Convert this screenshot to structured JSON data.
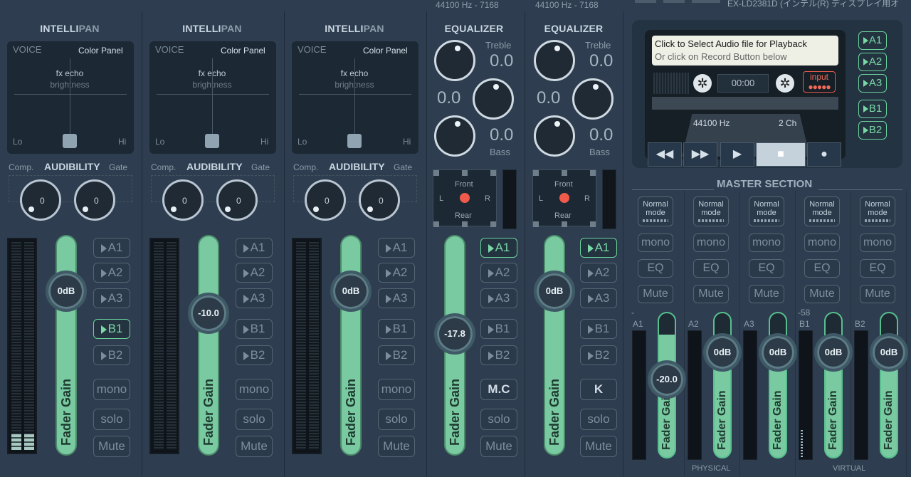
{
  "top": {
    "freq1": "44100 Hz - 7168",
    "freq2": "44100 Hz - 7168",
    "device": "EX-LD2381D (インテル(R) ディスプレイ用オ"
  },
  "strips": [
    {
      "id": "hw1",
      "pan": {
        "title_a": "INTELLI",
        "title_b": "PAN",
        "voice": "VOICE",
        "color": "Color Panel",
        "fx": "fx echo",
        "bright": "brightness",
        "lo": "Lo",
        "hi": "Hi"
      },
      "aud": {
        "comp": "Comp.",
        "title": "AUDIBILITY",
        "gate": "Gate",
        "k1": "0",
        "k2": "0"
      },
      "fader": {
        "value": "0dB",
        "label": "Fader Gain"
      },
      "buses": [
        {
          "label": "A1",
          "on": false
        },
        {
          "label": "A2",
          "on": false
        },
        {
          "label": "A3",
          "on": false
        },
        {
          "label": "B1",
          "on": true
        },
        {
          "label": "B2",
          "on": false
        }
      ],
      "btns": [
        "mono",
        "solo",
        "Mute"
      ]
    },
    {
      "id": "hw2",
      "pan": {
        "title_a": "INTELLI",
        "title_b": "PAN",
        "voice": "VOICE",
        "color": "Color Panel",
        "fx": "fx echo",
        "bright": "brightness",
        "lo": "Lo",
        "hi": "Hi"
      },
      "aud": {
        "comp": "Comp.",
        "title": "AUDIBILITY",
        "gate": "Gate",
        "k1": "0",
        "k2": "0"
      },
      "fader": {
        "value": "-10.0",
        "label": "Fader Gain"
      },
      "buses": [
        {
          "label": "A1",
          "on": false
        },
        {
          "label": "A2",
          "on": false
        },
        {
          "label": "A3",
          "on": false
        },
        {
          "label": "B1",
          "on": false
        },
        {
          "label": "B2",
          "on": false
        }
      ],
      "btns": [
        "mono",
        "solo",
        "Mute"
      ]
    },
    {
      "id": "hw3",
      "pan": {
        "title_a": "INTELLI",
        "title_b": "PAN",
        "voice": "VOICE",
        "color": "Color Panel",
        "fx": "fx echo",
        "bright": "brightness",
        "lo": "Lo",
        "hi": "Hi"
      },
      "aud": {
        "comp": "Comp.",
        "title": "AUDIBILITY",
        "gate": "Gate",
        "k1": "0",
        "k2": "0"
      },
      "fader": {
        "value": "0dB",
        "label": "Fader Gain"
      },
      "buses": [
        {
          "label": "A1",
          "on": false
        },
        {
          "label": "A2",
          "on": false
        },
        {
          "label": "A3",
          "on": false
        },
        {
          "label": "B1",
          "on": false
        },
        {
          "label": "B2",
          "on": false
        }
      ],
      "btns": [
        "mono",
        "solo",
        "Mute"
      ]
    }
  ],
  "virtual": [
    {
      "id": "v1",
      "eq": {
        "title": "EQUALIZER",
        "treble": "Treble",
        "bass": "Bass",
        "tv": "0.0",
        "mv": "0.0",
        "bv": "0.0"
      },
      "pan": {
        "front": "Front",
        "rear": "Rear",
        "l": "L",
        "r": "R"
      },
      "fader": {
        "value": "-17.8",
        "label": "Fader Gain"
      },
      "buses": [
        {
          "label": "A1",
          "on": true
        },
        {
          "label": "A2",
          "on": false
        },
        {
          "label": "A3",
          "on": false
        },
        {
          "label": "B1",
          "on": false
        },
        {
          "label": "B2",
          "on": false
        }
      ],
      "btns": [
        "M.C",
        "solo",
        "Mute"
      ]
    },
    {
      "id": "v2",
      "eq": {
        "title": "EQUALIZER",
        "treble": "Treble",
        "bass": "Bass",
        "tv": "0.0",
        "mv": "0.0",
        "bv": "0.0"
      },
      "pan": {
        "front": "Front",
        "rear": "Rear",
        "l": "L",
        "r": "R"
      },
      "fader": {
        "value": "0dB",
        "label": "Fader Gain"
      },
      "buses": [
        {
          "label": "A1",
          "on": true
        },
        {
          "label": "A2",
          "on": false
        },
        {
          "label": "A3",
          "on": false
        },
        {
          "label": "B1",
          "on": false
        },
        {
          "label": "B2",
          "on": false
        }
      ],
      "btns": [
        "K",
        "solo",
        "Mute"
      ]
    }
  ],
  "recorder": {
    "line1": "Click to Select Audio file for Playback",
    "line2": "Or click on Record Button below",
    "time": "00:00",
    "input": "input",
    "hz": "44100 Hz",
    "ch": "2 Ch",
    "buses": [
      "A1",
      "A2",
      "A3",
      "B1",
      "B2"
    ],
    "transport": [
      "◀◀",
      "▶▶",
      "▶",
      "■",
      "●"
    ]
  },
  "master": {
    "title": "MASTER SECTION",
    "physical": "PHYSICAL",
    "virtual": "VIRTUAL",
    "cols": [
      {
        "mode": "Normal",
        "mode2": "mode",
        "mono": "mono",
        "eq": "EQ",
        "mute": "Mute",
        "bus": "A1",
        "peak": "-",
        "fader": "-20.0",
        "label": "Fader Gain"
      },
      {
        "mode": "Normal",
        "mode2": "mode",
        "mono": "mono",
        "eq": "EQ",
        "mute": "Mute",
        "bus": "A2",
        "peak": "",
        "fader": "0dB",
        "label": "Fader Gain"
      },
      {
        "mode": "Normal",
        "mode2": "mode",
        "mono": "mono",
        "eq": "EQ",
        "mute": "Mute",
        "bus": "A3",
        "peak": "",
        "fader": "0dB",
        "label": "Fader Gain"
      },
      {
        "mode": "Normal",
        "mode2": "mode",
        "mono": "mono",
        "eq": "EQ",
        "mute": "Mute",
        "bus": "B1",
        "peak": "-58",
        "fader": "0dB",
        "label": "Fader Gain"
      },
      {
        "mode": "Normal",
        "mode2": "mode",
        "mono": "mono",
        "eq": "EQ",
        "mute": "Mute",
        "bus": "B2",
        "peak": "",
        "fader": "0dB",
        "label": "Fader Gain"
      }
    ]
  }
}
